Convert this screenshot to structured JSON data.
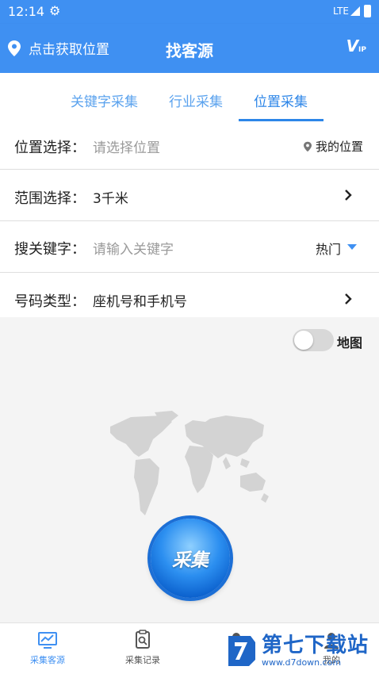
{
  "status_bar": {
    "time": "12:14",
    "network": "LTE"
  },
  "app_bar": {
    "location_label": "点击获取位置",
    "title": "找客源",
    "vip_badge": "V",
    "vip_small": "IP"
  },
  "tabs": [
    {
      "label": "关键字采集",
      "active": false
    },
    {
      "label": "行业采集",
      "active": false
    },
    {
      "label": "位置采集",
      "active": true
    }
  ],
  "form": {
    "location": {
      "label": "位置选择：",
      "placeholder": "请选择位置",
      "my_location": "我的位置"
    },
    "range": {
      "label": "范围选择：",
      "value": "3千米"
    },
    "keyword": {
      "label": "搜关键字：",
      "placeholder": "请输入关键字",
      "hot": "热门"
    },
    "phone_type": {
      "label": "号码类型：",
      "value": "座机号和手机号"
    }
  },
  "map_toggle": {
    "label": "地图",
    "on": false
  },
  "collect_button": {
    "label": "采集"
  },
  "bottom_nav": [
    {
      "label": "采集客源",
      "active": true,
      "icon": "monitor-chart-icon"
    },
    {
      "label": "采集记录",
      "active": false,
      "icon": "clipboard-search-icon"
    },
    {
      "label": "",
      "active": false,
      "icon": "user-icon"
    },
    {
      "label": "我的",
      "active": false,
      "icon": "person-icon"
    }
  ],
  "watermark": {
    "name": "第七下载站",
    "url": "www.d7down.com"
  },
  "colors": {
    "primary": "#3f90f2",
    "tab_active": "#2d86e8",
    "tab_inactive": "#5aa2ee"
  }
}
